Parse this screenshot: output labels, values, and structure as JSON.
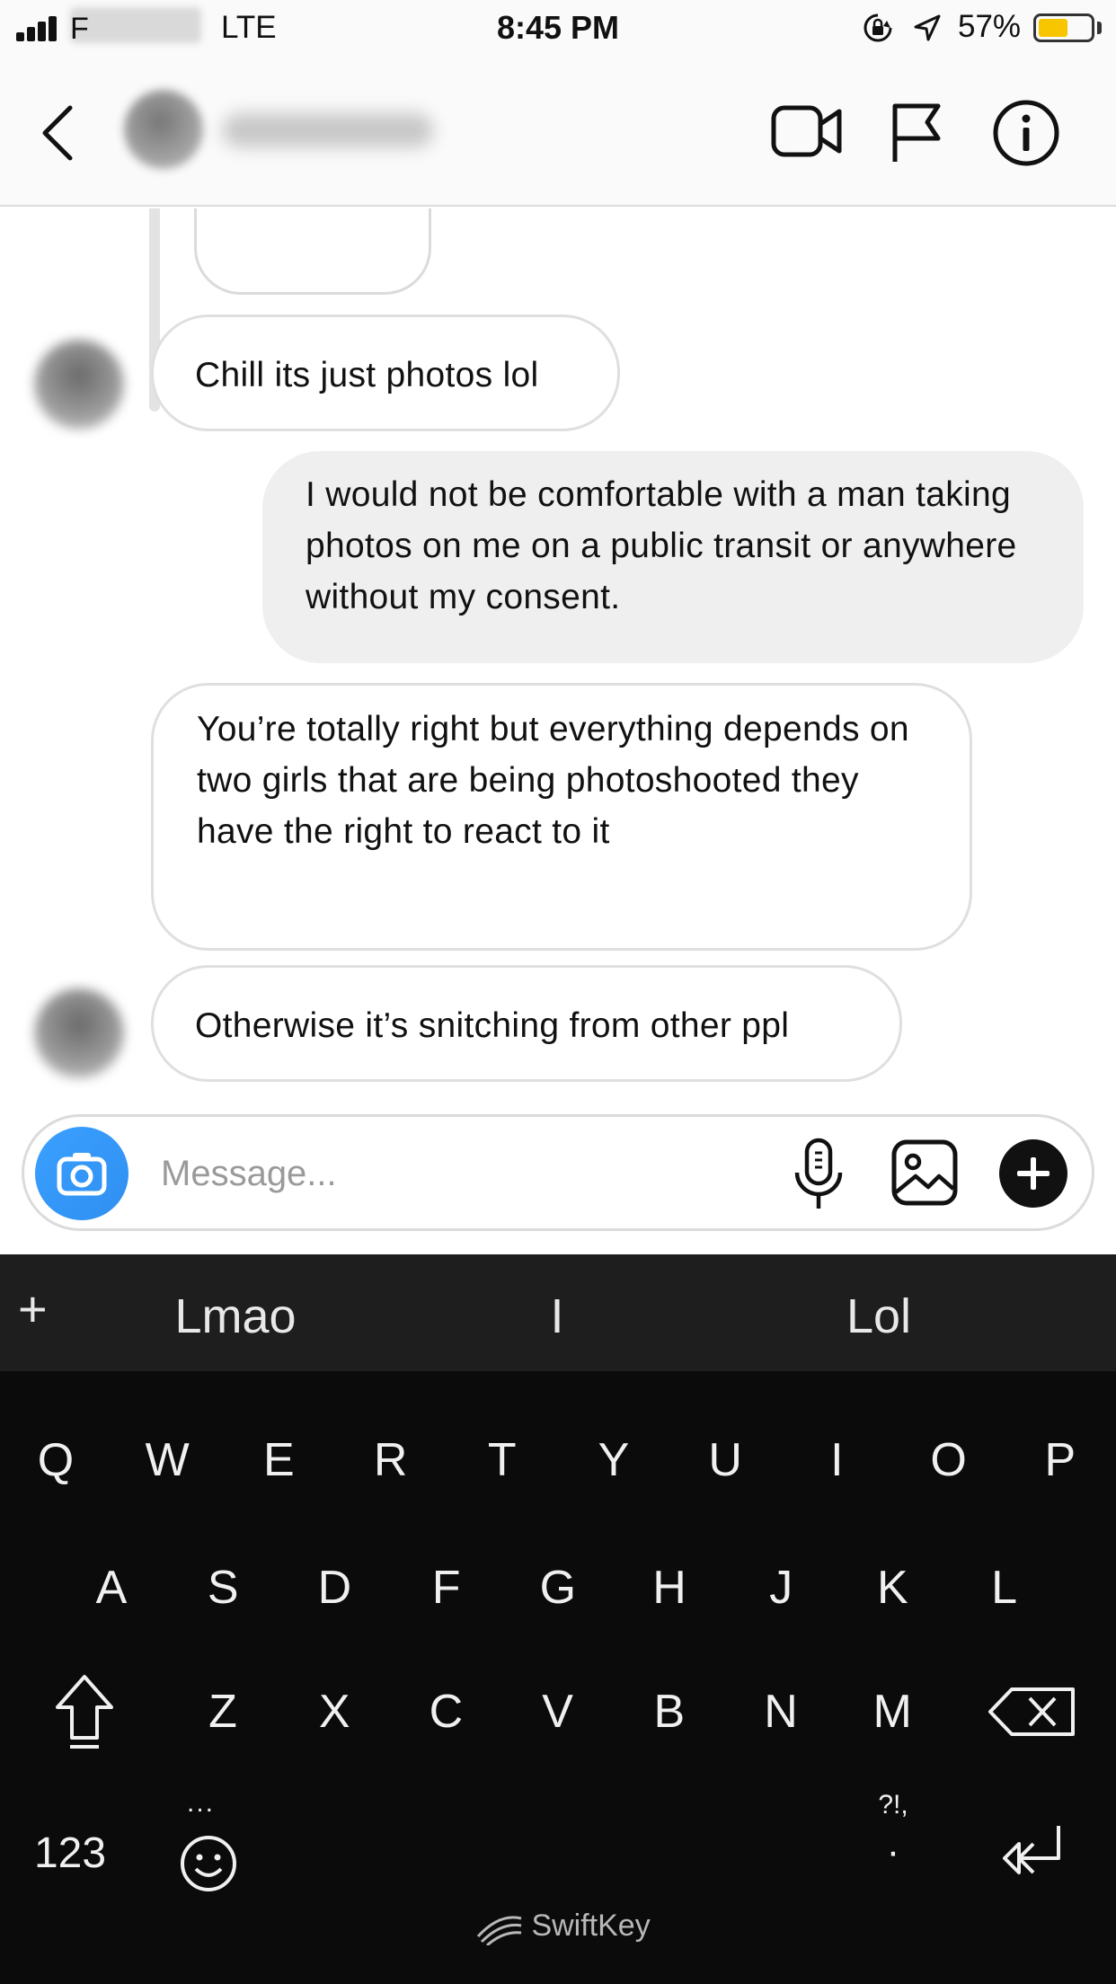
{
  "status_bar": {
    "carrier_visible": "F",
    "network": "LTE",
    "time": "8:45 PM",
    "battery_pct": "57%",
    "battery_level": 0.57,
    "battery_color": "#f7c600"
  },
  "header": {
    "back_icon": "chevron-left-icon",
    "icons": [
      "video-camera-icon",
      "flag-icon",
      "info-icon"
    ]
  },
  "messages": [
    {
      "direction": "incoming",
      "text": "Chill its just photos lol",
      "avatar": true
    },
    {
      "direction": "outgoing",
      "text": "I would not be comfortable with a man taking photos on me on a public transit or anywhere without my consent."
    },
    {
      "direction": "incoming",
      "text": "You’re totally right but everything depends on two girls that are being photoshooted they have the right to react to it",
      "avatar": false
    },
    {
      "direction": "incoming",
      "text": "Otherwise it’s snitching from other ppl",
      "avatar": true
    }
  ],
  "composer": {
    "placeholder": "Message...",
    "accent": "#3897f0"
  },
  "keyboard": {
    "suggestions": [
      "Lmao",
      "I",
      "Lol"
    ],
    "row1": [
      "Q",
      "W",
      "E",
      "R",
      "T",
      "Y",
      "U",
      "I",
      "O",
      "P"
    ],
    "row2": [
      "A",
      "S",
      "D",
      "F",
      "G",
      "H",
      "J",
      "K",
      "L"
    ],
    "row3": [
      "Z",
      "X",
      "C",
      "V",
      "B",
      "N",
      "M"
    ],
    "number_key": "123",
    "punctuation_key": "?!,",
    "brand": "SwiftKey",
    "ellipsis": "..."
  }
}
